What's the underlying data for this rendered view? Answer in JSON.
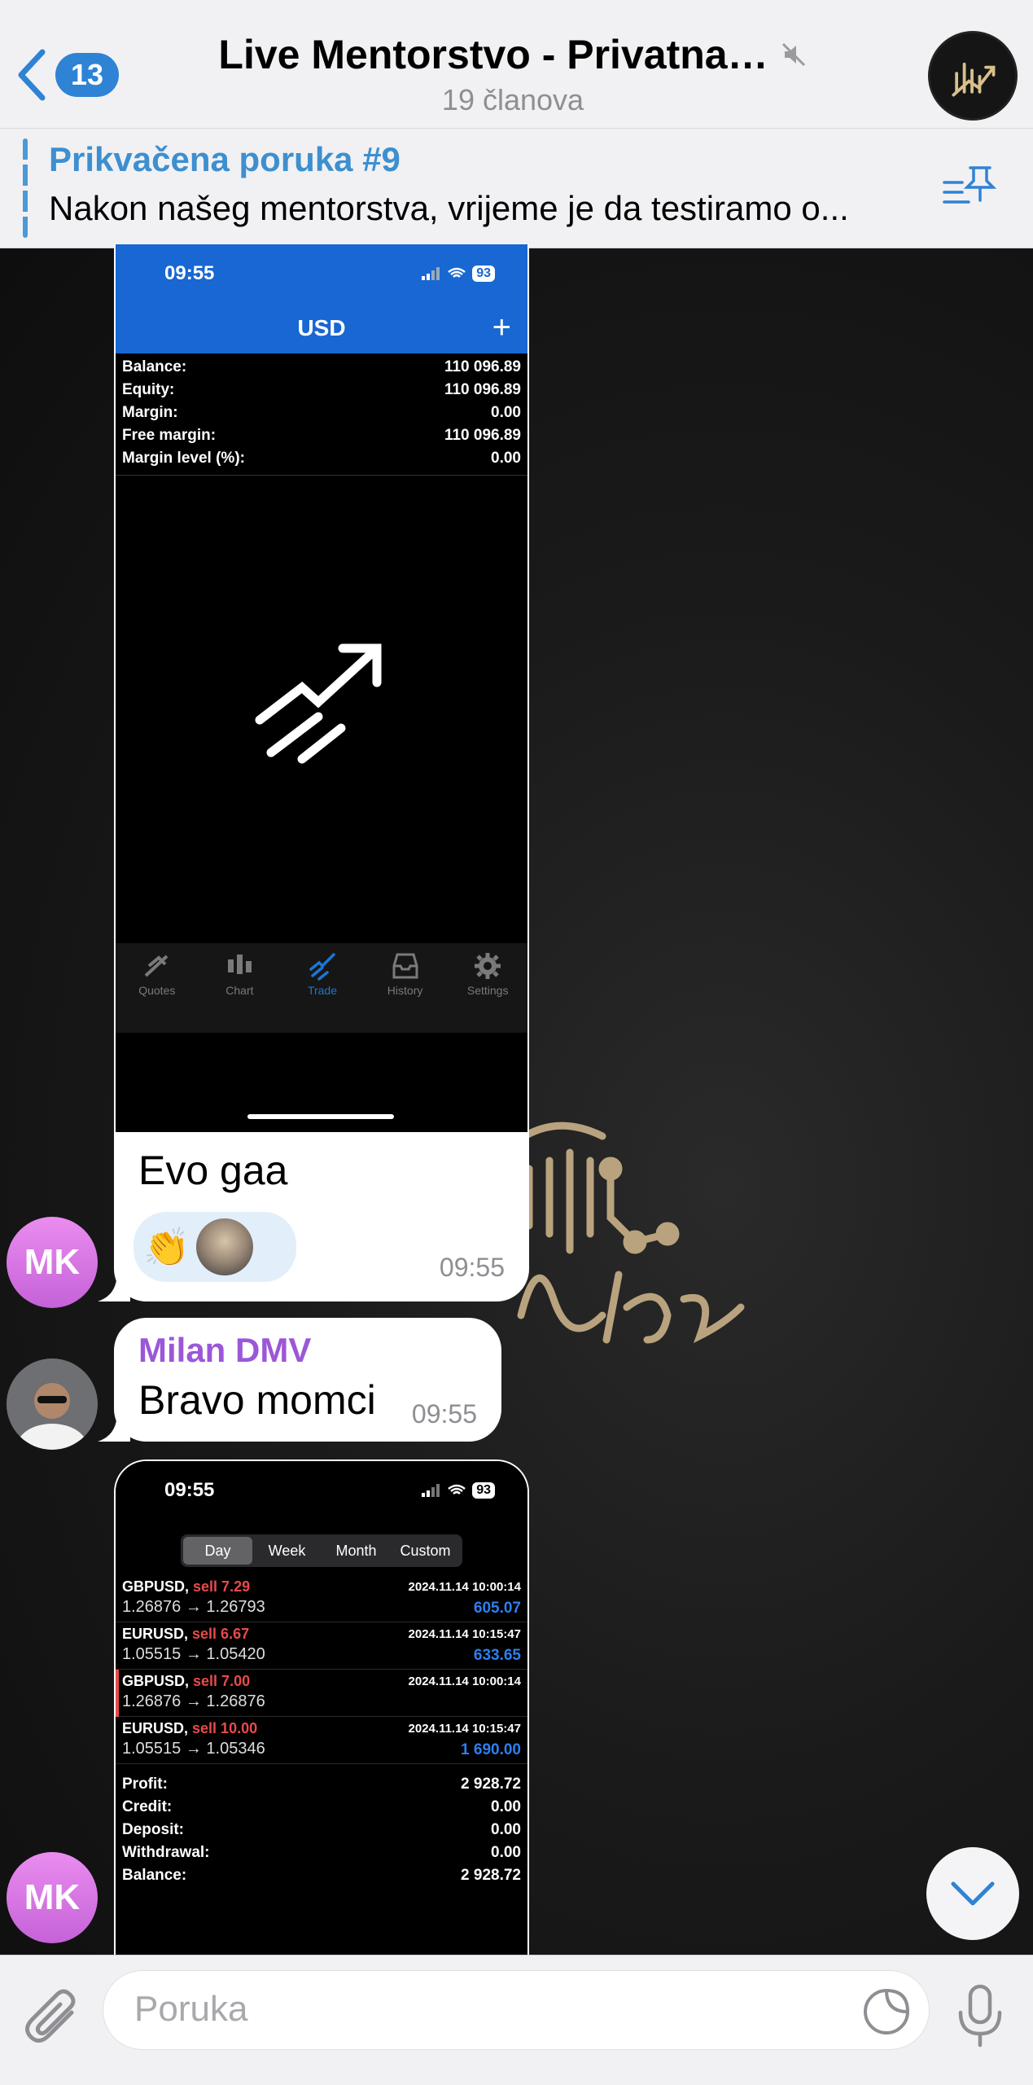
{
  "header": {
    "unread_count": "13",
    "title": "Live Mentorstvo - Privatna…",
    "members": "19 članova"
  },
  "pinned": {
    "title": "Prikvačena poruka #9",
    "text": "Nakon našeg mentorstva, vrijeme je da testiramo o..."
  },
  "screenshot1": {
    "status_time": "09:55",
    "battery": "93",
    "currency": "USD",
    "account": [
      {
        "label": "Balance:",
        "value": "110 096.89"
      },
      {
        "label": "Equity:",
        "value": "110 096.89"
      },
      {
        "label": "Margin:",
        "value": "0.00"
      },
      {
        "label": "Free margin:",
        "value": "110 096.89"
      },
      {
        "label": "Margin level (%):",
        "value": "0.00"
      }
    ],
    "tabs": [
      "Quotes",
      "Chart",
      "Trade",
      "History",
      "Settings"
    ]
  },
  "messages": {
    "m1": {
      "text": "Evo gaa",
      "time": "09:55",
      "avatar": "MK",
      "reaction": "👏"
    },
    "m2": {
      "sender": "Milan DMV",
      "text": "Bravo momci",
      "time": "09:55"
    },
    "m3_avatar": "MK"
  },
  "screenshot2": {
    "status_time": "09:55",
    "battery": "93",
    "segments": [
      "Day",
      "Week",
      "Month",
      "Custom"
    ],
    "deals": [
      {
        "symbol": "GBPUSD,",
        "side": "sell 7.29",
        "date": "2024.11.14 10:00:14",
        "prices": "1.26876 → 1.26793",
        "profit": "605.07"
      },
      {
        "symbol": "EURUSD,",
        "side": "sell 6.67",
        "date": "2024.11.14 10:15:47",
        "prices": "1.05515 → 1.05420",
        "profit": "633.65"
      },
      {
        "symbol": "GBPUSD,",
        "side": "sell 7.00",
        "date": "2024.11.14 10:00:14",
        "prices": "1.26876 → 1.26876",
        "profit": ""
      },
      {
        "symbol": "EURUSD,",
        "side": "sell 10.00",
        "date": "2024.11.14 10:15:47",
        "prices": "1.05515 → 1.05346",
        "profit": "1 690.00"
      }
    ],
    "summary": [
      {
        "label": "Profit:",
        "value": "2 928.72"
      },
      {
        "label": "Credit:",
        "value": "0.00"
      },
      {
        "label": "Deposit:",
        "value": "0.00"
      },
      {
        "label": "Withdrawal:",
        "value": "0.00"
      },
      {
        "label": "Balance:",
        "value": "2 928.72"
      }
    ]
  },
  "input": {
    "placeholder": "Poruka"
  },
  "colors": {
    "accent": "#2f83d4",
    "sender_name": "#9b57d8",
    "mt_blue": "#1867d2",
    "sell_red": "#e84a4a"
  }
}
